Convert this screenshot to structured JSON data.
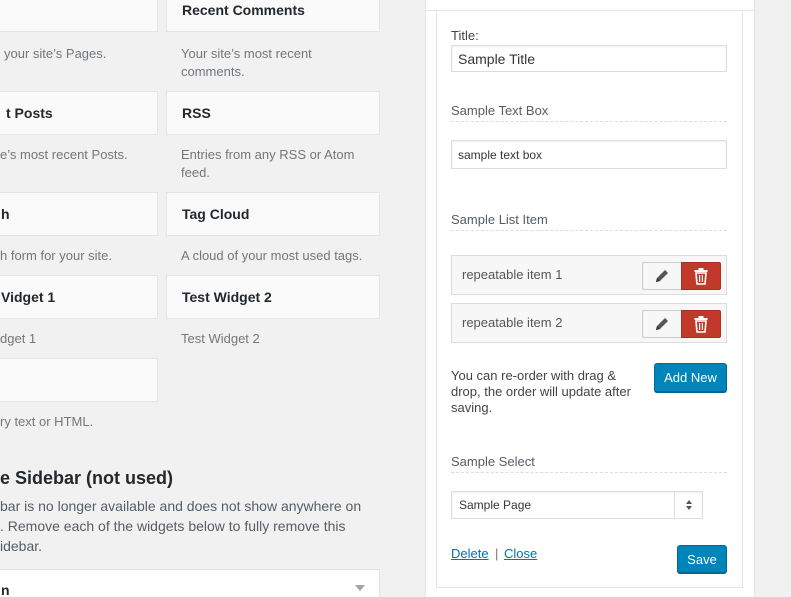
{
  "available_widgets": [
    {
      "title": "",
      "desc": "your site’s Pages."
    },
    {
      "title": "Recent Comments",
      "desc_lines": [
        "Your site’s most recent",
        "comments."
      ]
    },
    {
      "title": "t Posts",
      "desc": "e’s most recent Posts."
    },
    {
      "title": "RSS",
      "desc_lines": [
        "Entries from any RSS or Atom",
        "feed."
      ]
    },
    {
      "title": "h",
      "desc": "h form for your site."
    },
    {
      "title": "Tag Cloud",
      "desc": "A cloud of your most used tags."
    },
    {
      "title": "Vidget 1",
      "desc": "dget 1"
    },
    {
      "title": "Test Widget 2",
      "desc": "Test Widget 2"
    },
    {
      "title": "",
      "desc": "ry text or HTML."
    }
  ],
  "inactive_sidebar": {
    "title": "e Sidebar (not used)",
    "desc_lines": [
      "bar is no longer available and does not show anywhere on",
      ". Remove each of the widgets below to fully remove this",
      "idebar."
    ],
    "collapsed_widget_title": "n"
  },
  "editor": {
    "title_label": "Title:",
    "title_value": "Sample Title",
    "textbox_section": "Sample Text Box",
    "textbox_value": "sample text box",
    "list_section": "Sample List Item",
    "list_items": [
      {
        "label": "repeatable item 1"
      },
      {
        "label": "repeatable item 2"
      }
    ],
    "reorder_help_lines": [
      "You can re-order with drag &",
      "drop, the order will update after",
      "saving."
    ],
    "add_new_label": "Add New",
    "select_section": "Sample Select",
    "select_value": "Sample Page",
    "delete_label": "Delete",
    "separator": "|",
    "close_label": "Close",
    "save_label": "Save"
  },
  "icons": {
    "edit": "pencil-icon",
    "delete": "trash-icon",
    "select": "select-arrows-icon",
    "collapse": "triangle-down-icon"
  },
  "colors": {
    "primary": "#0085ba",
    "danger": "#c0392b",
    "link": "#0073aa",
    "background": "#f1f1f1"
  }
}
